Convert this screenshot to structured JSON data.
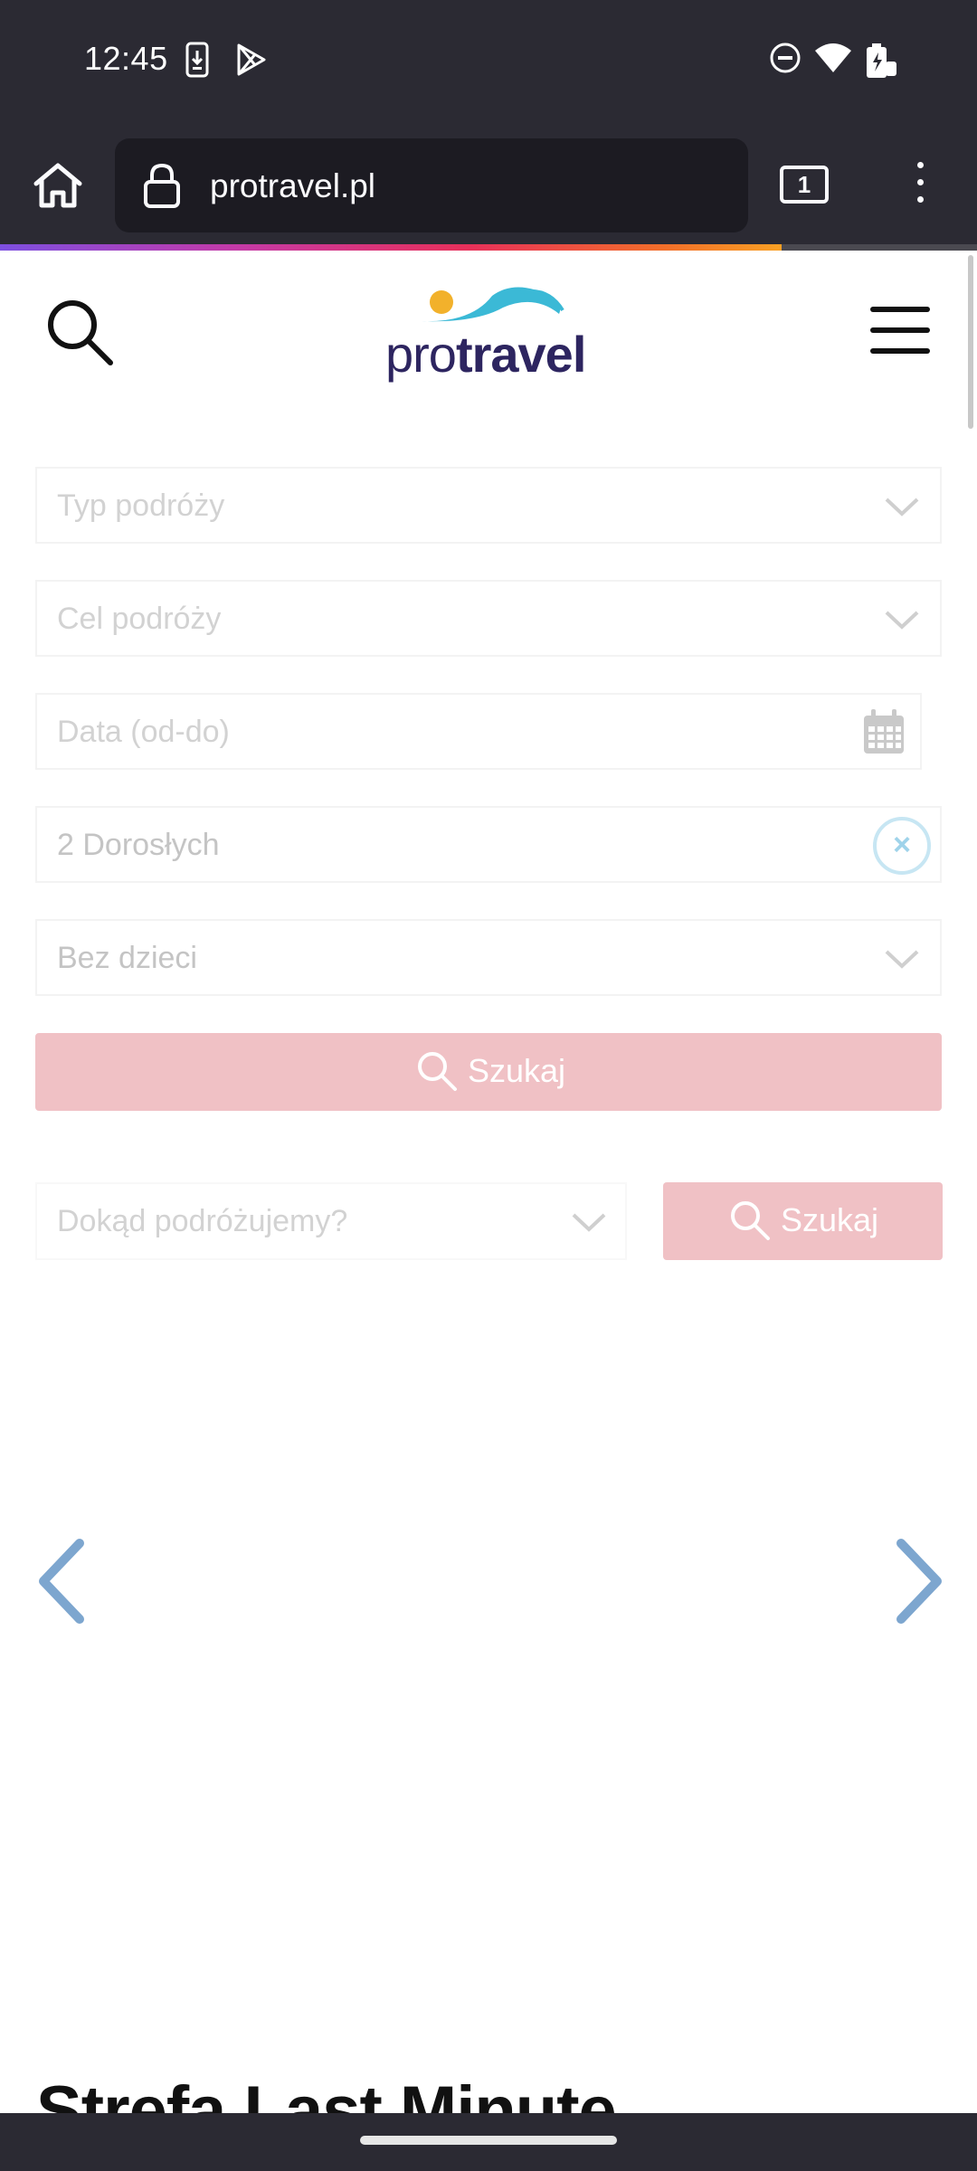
{
  "status_bar": {
    "time": "12:45",
    "icons": [
      "download-icon",
      "play-store-icon",
      "do-not-disturb-icon",
      "wifi-icon",
      "battery-charging-icon"
    ]
  },
  "browser": {
    "url": "protravel.pl",
    "tab_count": "1",
    "load_progress": 0.8
  },
  "header": {
    "logo_light": "pro",
    "logo_bold": "travel",
    "logo_colors": {
      "sun": "#f2b12b",
      "wave": "#3bb9d6",
      "text": "#2d2560"
    }
  },
  "search_form": {
    "trip_type_placeholder": "Typ podróży",
    "destination_placeholder": "Cel podróży",
    "date_placeholder": "Data (od-do)",
    "adults_value": "2 Dorosłych",
    "children_value": "Bez dzieci",
    "search_label": "Szukaj"
  },
  "quick_search": {
    "placeholder": "Dokąd podróżujemy?",
    "search_label": "Szukaj"
  },
  "section": {
    "title": "Strefa Last Minute"
  },
  "colors": {
    "accent_button": "#f0c1c5",
    "carousel_arrow": "#7da6cf",
    "browser_chrome": "#2b2a33"
  }
}
